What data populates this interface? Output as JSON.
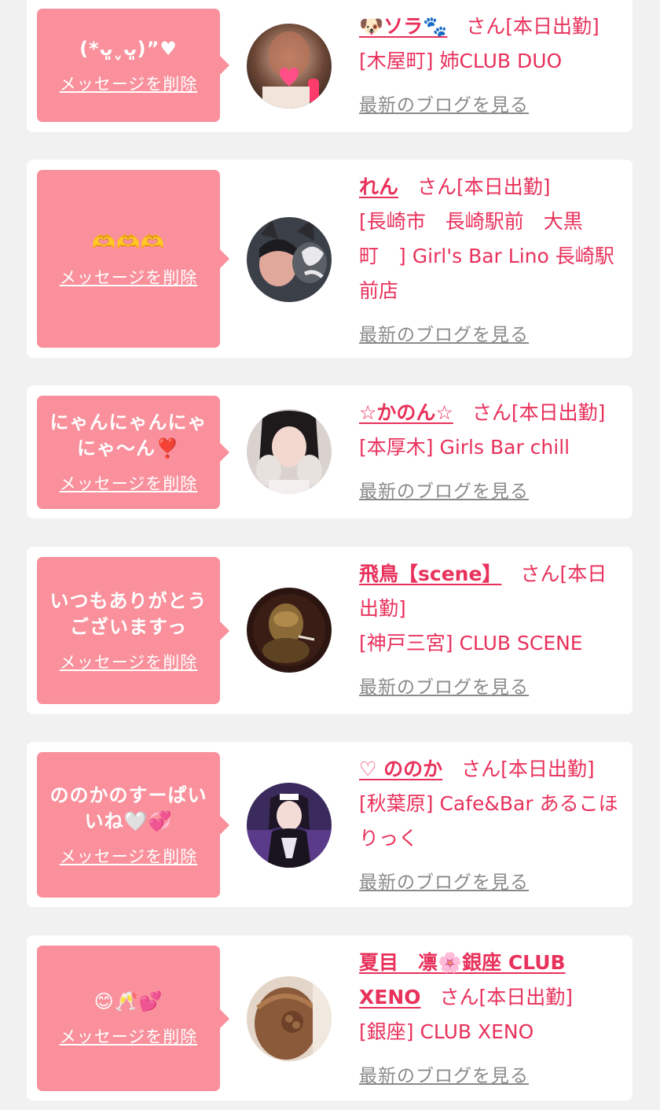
{
  "common": {
    "delete_label": "メッセージを削除",
    "blog_label": "最新のブログを見る",
    "san_label": "さん",
    "attendance": "[本日出勤]"
  },
  "colors": {
    "page_bg": "#f1f1f1",
    "bubble_bg": "#f9909b",
    "accent_pink": "#e8315b",
    "link_gray": "#8a8a8a"
  },
  "entries": [
    {
      "message": "(*ᴗ͈ˬᴗ͈)”♥",
      "name": "🐶ソラ🐾",
      "shop": "[木屋町] 姉CLUB DUO"
    },
    {
      "message": "🫶🫶🫶",
      "name": "れん",
      "shop": "[長崎市　長崎駅前　大黒町　] Girl's Bar Lino 長崎駅前店"
    },
    {
      "message": "にゃんにゃんにゃにゃ〜ん❣️",
      "name": "☆かのん☆",
      "shop": "[本厚木] Girls Bar chill"
    },
    {
      "message": "いつもありがとうございますっ",
      "name": "飛鳥【scene】",
      "shop": "[神戸三宮] CLUB SCENE"
    },
    {
      "message": "ののかのすーぱいいね🤍💞",
      "name": "♡ ののか",
      "shop": "[秋葉原] Cafe&Bar あるこほりっく"
    },
    {
      "message": "😊🥂💕",
      "name": "夏目　凛🌸銀座 CLUB XENO",
      "shop": "[銀座] CLUB XENO"
    }
  ]
}
